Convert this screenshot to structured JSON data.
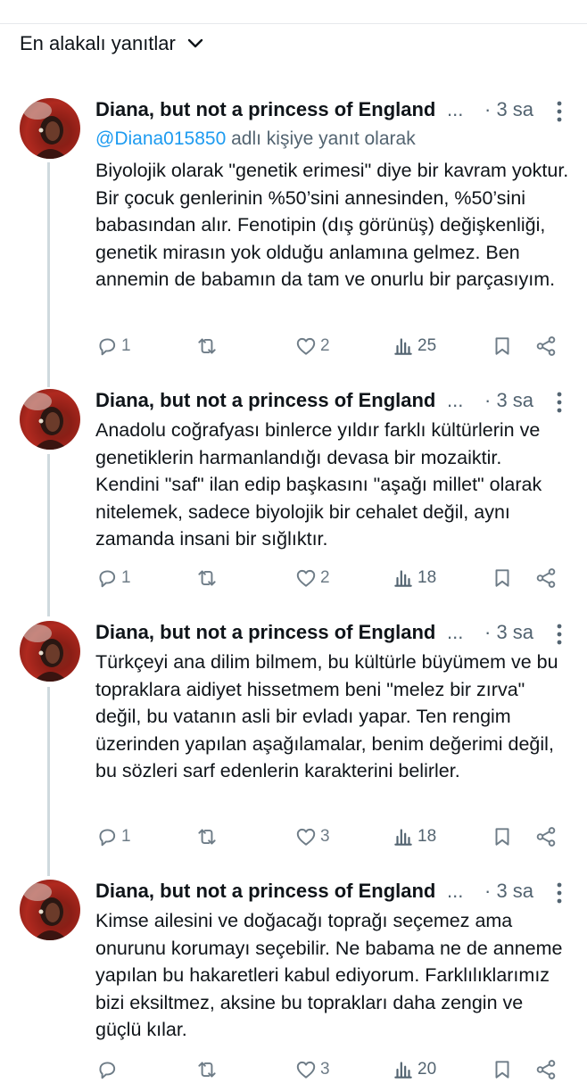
{
  "sort": {
    "label": "En alakalı yanıtlar"
  },
  "tweets": [
    {
      "name": "Diana, but not a princess of England",
      "ellipsis": "...",
      "time": "· 3 sa",
      "reply_prefix": "@Diana015850",
      "reply_suffix": " adlı kişiye yanıt olarak",
      "text": "Biyolojik olarak \"genetik erimesi\" diye bir kavram yoktur. Bir çocuk genlerinin %50’sini annesinden, %50’sini babasından alır. Fenotipin (dış görünüş) değişkenliği, genetik mirasın yok olduğu anlamına gelmez. Ben annemin de babamın da tam ve onurlu bir parçasıyım.",
      "replies": "1",
      "retweets": "",
      "likes": "2",
      "views": "25"
    },
    {
      "name": "Diana, but not a princess of England",
      "ellipsis": "...",
      "time": "· 3 sa",
      "text": "Anadolu coğrafyası binlerce yıldır farklı kültürlerin ve genetiklerin harmanlandığı devasa bir mozaiktir. Kendini \"saf\" ilan edip başkasını \"aşağı millet\" olarak nitelemek, sadece biyolojik bir cehalet değil, aynı zamanda insani bir sığlıktır.",
      "replies": "1",
      "retweets": "",
      "likes": "2",
      "views": "18"
    },
    {
      "name": "Diana, but not a princess of England",
      "ellipsis": "...",
      "time": "· 3 sa",
      "text": "Türkçeyi ana dilim bilmem, bu kültürle büyümem ve bu topraklara aidiyet hissetmem beni \"melez bir zırva\" değil, bu vatanın asli bir evladı yapar. Ten rengim üzerinden yapılan aşağılamalar, benim değerimi değil, bu sözleri sarf edenlerin karakterini belirler.",
      "replies": "1",
      "retweets": "",
      "likes": "3",
      "views": "18"
    },
    {
      "name": "Diana, but not a princess of England",
      "ellipsis": "...",
      "time": "· 3 sa",
      "text": "Kimse ailesini ve doğacağı toprağı seçemez ama onurunu korumayı seçebilir. Ne babama ne de anneme yapılan bu hakaretleri kabul ediyorum. Farklılıklarımız bizi eksiltmez, aksine bu toprakları daha zengin ve güçlü kılar.",
      "replies": "",
      "retweets": "",
      "likes": "3",
      "views": "20"
    }
  ],
  "colors": {
    "text": "#0f1419",
    "muted": "#536471",
    "link": "#1d9bf0",
    "thread": "#cfd9de"
  }
}
